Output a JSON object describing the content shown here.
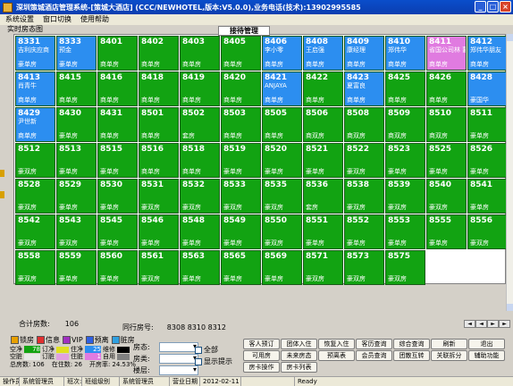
{
  "window": {
    "title": "深圳策城酒店管理系统-[策城大酒店] (CCC/NEWHOTEL,版本:V5.0.0),业务电话(技术):13902995585",
    "minimize": "_",
    "maximize": "□",
    "close": "×"
  },
  "menu": [
    "系统设置",
    "窗口切换",
    "使用帮助"
  ],
  "panel": {
    "title": "实时房态图",
    "center_tab": "接待管理"
  },
  "rooms": [
    {
      "no": "8331",
      "guest": "吉利庆应商",
      "type": "豪单房",
      "color": "blue"
    },
    {
      "no": "8333",
      "guest": "预金",
      "type": "豪单房",
      "color": "blue"
    },
    {
      "no": "8401",
      "guest": "",
      "type": "商单房",
      "color": "green"
    },
    {
      "no": "8402",
      "guest": "",
      "type": "商单房",
      "color": "green"
    },
    {
      "no": "8403",
      "guest": "",
      "type": "商单房",
      "color": "green"
    },
    {
      "no": "8405",
      "guest": "",
      "type": "商单房",
      "color": "green"
    },
    {
      "no": "8406",
      "guest": "李小零",
      "type": "商单房",
      "color": "blue"
    },
    {
      "no": "8408",
      "guest": "王启强",
      "type": "商单房",
      "color": "blue"
    },
    {
      "no": "8409",
      "guest": "康经理",
      "type": "商单房",
      "color": "blue"
    },
    {
      "no": "8410",
      "guest": "郑伟华",
      "type": "商单房",
      "color": "blue"
    },
    {
      "no": "8411",
      "guest": "省国公司林 蒙",
      "type": "商单房",
      "color": "pink"
    },
    {
      "no": "8412",
      "guest": "郑伟华朋友",
      "type": "商单房",
      "color": "blue"
    },
    {
      "no": "8413",
      "guest": "肖青牛",
      "type": "商单房",
      "color": "blue"
    },
    {
      "no": "8415",
      "guest": "",
      "type": "商单房",
      "color": "green"
    },
    {
      "no": "8416",
      "guest": "",
      "type": "商单房",
      "color": "green"
    },
    {
      "no": "8418",
      "guest": "",
      "type": "商单房",
      "color": "green"
    },
    {
      "no": "8419",
      "guest": "",
      "type": "商单房",
      "color": "green"
    },
    {
      "no": "8420",
      "guest": "",
      "type": "商单房",
      "color": "green"
    },
    {
      "no": "8421",
      "guest": "ANJAYA",
      "type": "商单房",
      "color": "blue"
    },
    {
      "no": "8422",
      "guest": "",
      "type": "商单房",
      "color": "green"
    },
    {
      "no": "8423",
      "guest": "夏富良",
      "type": "商单房",
      "color": "blue"
    },
    {
      "no": "8425",
      "guest": "",
      "type": "商单房",
      "color": "green"
    },
    {
      "no": "8426",
      "guest": "",
      "type": "商单房",
      "color": "green"
    },
    {
      "no": "8428",
      "guest": "",
      "type": "豪国华",
      "color": "blue"
    },
    {
      "no": "8429",
      "guest": "尹世新",
      "type": "商单房",
      "color": "blue"
    },
    {
      "no": "8430",
      "guest": "",
      "type": "豪单房",
      "color": "green"
    },
    {
      "no": "8431",
      "guest": "",
      "type": "商单房",
      "color": "green"
    },
    {
      "no": "8501",
      "guest": "",
      "type": "商单房",
      "color": "green"
    },
    {
      "no": "8502",
      "guest": "",
      "type": "套房",
      "color": "green"
    },
    {
      "no": "8503",
      "guest": "",
      "type": "商单房",
      "color": "green"
    },
    {
      "no": "8505",
      "guest": "",
      "type": "商单房",
      "color": "green"
    },
    {
      "no": "8506",
      "guest": "",
      "type": "商双房",
      "color": "green"
    },
    {
      "no": "8508",
      "guest": "",
      "type": "商双房",
      "color": "green"
    },
    {
      "no": "8509",
      "guest": "",
      "type": "商双房",
      "color": "green"
    },
    {
      "no": "8510",
      "guest": "",
      "type": "商双房",
      "color": "green"
    },
    {
      "no": "8511",
      "guest": "",
      "type": "豪单房",
      "color": "green"
    },
    {
      "no": "8512",
      "guest": "",
      "type": "豪双房",
      "color": "green"
    },
    {
      "no": "8513",
      "guest": "",
      "type": "豪单房",
      "color": "green"
    },
    {
      "no": "8515",
      "guest": "",
      "type": "豪单房",
      "color": "green"
    },
    {
      "no": "8516",
      "guest": "",
      "type": "商单房",
      "color": "green"
    },
    {
      "no": "8518",
      "guest": "",
      "type": "商单房",
      "color": "green"
    },
    {
      "no": "8519",
      "guest": "",
      "type": "豪单房",
      "color": "green"
    },
    {
      "no": "8520",
      "guest": "",
      "type": "豪单房",
      "color": "green"
    },
    {
      "no": "8521",
      "guest": "",
      "type": "豪单房",
      "color": "green"
    },
    {
      "no": "8522",
      "guest": "",
      "type": "豪双房",
      "color": "green"
    },
    {
      "no": "8523",
      "guest": "",
      "type": "豪单房",
      "color": "green"
    },
    {
      "no": "8525",
      "guest": "",
      "type": "豪单房",
      "color": "green"
    },
    {
      "no": "8526",
      "guest": "",
      "type": "豪单房",
      "color": "green"
    },
    {
      "no": "8528",
      "guest": "",
      "type": "豪双房",
      "color": "green"
    },
    {
      "no": "8529",
      "guest": "",
      "type": "豪单房",
      "color": "green"
    },
    {
      "no": "8530",
      "guest": "",
      "type": "豪单房",
      "color": "green"
    },
    {
      "no": "8531",
      "guest": "",
      "type": "豪双房",
      "color": "green"
    },
    {
      "no": "8532",
      "guest": "",
      "type": "豪双房",
      "color": "green"
    },
    {
      "no": "8533",
      "guest": "",
      "type": "豪双房",
      "color": "green"
    },
    {
      "no": "8535",
      "guest": "",
      "type": "豪双房",
      "color": "green"
    },
    {
      "no": "8536",
      "guest": "",
      "type": "套房",
      "color": "green"
    },
    {
      "no": "8538",
      "guest": "",
      "type": "豪双房",
      "color": "green"
    },
    {
      "no": "8539",
      "guest": "",
      "type": "豪双房",
      "color": "green"
    },
    {
      "no": "8540",
      "guest": "",
      "type": "豪双房",
      "color": "green"
    },
    {
      "no": "8541",
      "guest": "",
      "type": "豪单房",
      "color": "green"
    },
    {
      "no": "8542",
      "guest": "",
      "type": "豪双房",
      "color": "green"
    },
    {
      "no": "8543",
      "guest": "",
      "type": "豪双房",
      "color": "green"
    },
    {
      "no": "8545",
      "guest": "",
      "type": "豪单房",
      "color": "green"
    },
    {
      "no": "8546",
      "guest": "",
      "type": "豪单房",
      "color": "green"
    },
    {
      "no": "8548",
      "guest": "",
      "type": "豪单房",
      "color": "green"
    },
    {
      "no": "8549",
      "guest": "",
      "type": "豪单房",
      "color": "green"
    },
    {
      "no": "8550",
      "guest": "",
      "type": "豪双房",
      "color": "green"
    },
    {
      "no": "8551",
      "guest": "",
      "type": "豪单房",
      "color": "green"
    },
    {
      "no": "8552",
      "guest": "",
      "type": "豪单房",
      "color": "green"
    },
    {
      "no": "8553",
      "guest": "",
      "type": "豪单房",
      "color": "green"
    },
    {
      "no": "8555",
      "guest": "",
      "type": "豪单房",
      "color": "green"
    },
    {
      "no": "8556",
      "guest": "",
      "type": "豪双房",
      "color": "green"
    },
    {
      "no": "8558",
      "guest": "",
      "type": "豪双房",
      "color": "green"
    },
    {
      "no": "8559",
      "guest": "",
      "type": "豪单房",
      "color": "green"
    },
    {
      "no": "8560",
      "guest": "",
      "type": "豪单房",
      "color": "green"
    },
    {
      "no": "8561",
      "guest": "",
      "type": "豪双房",
      "color": "green"
    },
    {
      "no": "8563",
      "guest": "",
      "type": "豪单房",
      "color": "green"
    },
    {
      "no": "8565",
      "guest": "",
      "type": "豪单房",
      "color": "green"
    },
    {
      "no": "8569",
      "guest": "",
      "type": "豪单房",
      "color": "green"
    },
    {
      "no": "8571",
      "guest": "",
      "type": "豪双房",
      "color": "green"
    },
    {
      "no": "8573",
      "guest": "",
      "type": "豪双房",
      "color": "green"
    },
    {
      "no": "8575",
      "guest": "",
      "type": "豪双房",
      "color": "green"
    }
  ],
  "summary": {
    "total_rooms_label": "合计房数:",
    "total_rooms_value": "106",
    "same_rooms_label": "同行房号:",
    "same_rooms_value": "8308 8310 8312"
  },
  "nav_buttons": [
    "◄",
    "◄",
    "►",
    "►"
  ],
  "legend": [
    "锁房",
    "信息",
    "VIP",
    "预离",
    "脏房"
  ],
  "status": {
    "rows": [
      [
        {
          "label": "空净",
          "value": "78",
          "color": "#12a312"
        },
        {
          "label": "订净",
          "value": "",
          "color": "#e0e020"
        },
        {
          "label": "住净",
          "value": "25",
          "color": "#2c8ef0"
        },
        {
          "label": "维修",
          "value": "",
          "color": "#000000"
        }
      ],
      [
        {
          "label": "空脏",
          "value": "",
          "color": "#e8e8e8"
        },
        {
          "label": "订脏",
          "value": "",
          "color": "#e0a0e0"
        },
        {
          "label": "住脏",
          "value": "1",
          "color": "#e07be0"
        },
        {
          "label": "自用",
          "value": "",
          "color": "#808080"
        }
      ]
    ],
    "footer": [
      {
        "label": "总房数:",
        "value": "106"
      },
      {
        "label": "在住数:",
        "value": "26"
      },
      {
        "label": "开房率:",
        "value": "24.53%"
      }
    ]
  },
  "filters": [
    {
      "label": "房态:",
      "value": ""
    },
    {
      "label": "房类:",
      "value": ""
    },
    {
      "label": "楼层:",
      "value": ""
    }
  ],
  "checks": [
    "全部",
    "显示提示"
  ],
  "action_buttons": [
    [
      "客人预订",
      "团体入住",
      "恢复入住",
      "客历查询",
      "综合查询",
      "刷新",
      "退出"
    ],
    [
      "可用房",
      "未来房态",
      "预离表",
      "会员查询",
      "团散互转",
      "关联拆分",
      "辅助功能"
    ],
    [
      "房卡操作",
      "房卡列表"
    ]
  ],
  "statusbar": [
    "操作员",
    "系统管理员",
    "班次:",
    "班组级别",
    "系统管理员",
    "营业日期",
    "2012-02-11",
    "",
    "Ready"
  ]
}
